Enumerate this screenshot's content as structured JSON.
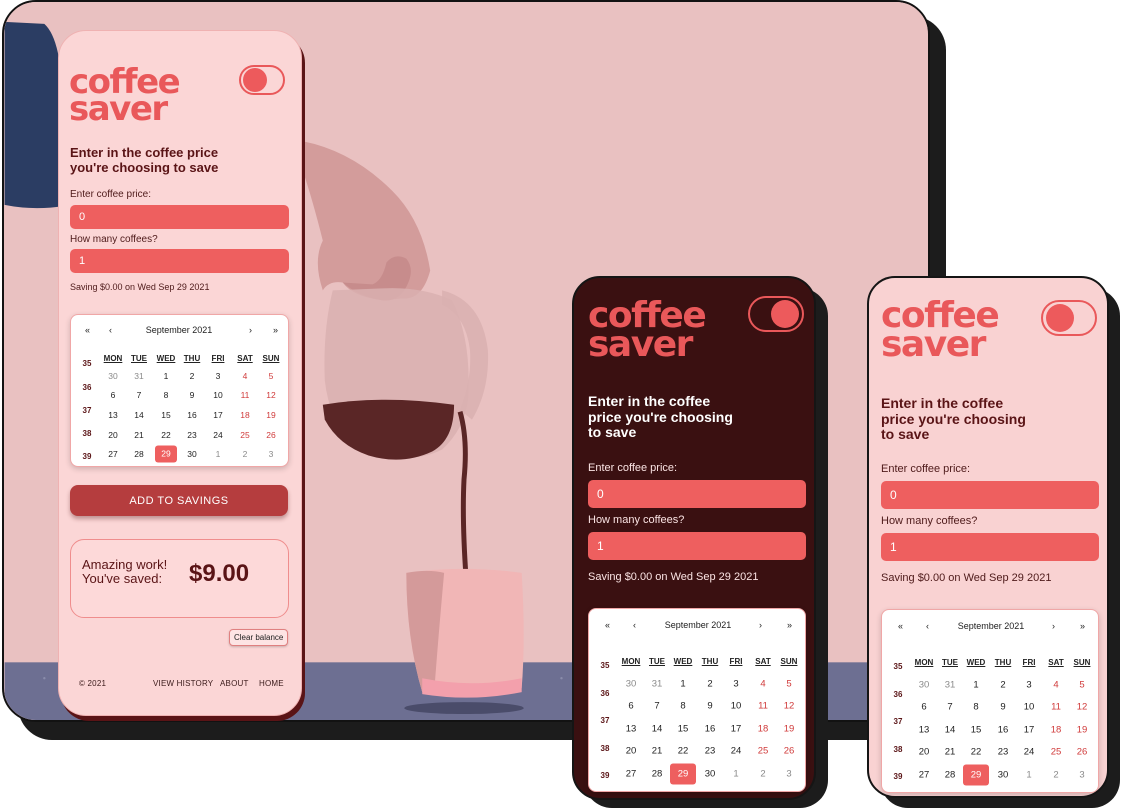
{
  "app": {
    "logo_line1": "coffee",
    "logo_line2": "saver",
    "heading_line1": "Enter in the coffee",
    "heading_line2": "price you're choosing",
    "heading_line3": "to save",
    "heading_wide_line1": "Enter in the coffee price",
    "heading_wide_line2": "you're choosing to save",
    "price_label": "Enter coffee price:",
    "price_value": "0",
    "count_label": "How many coffees?",
    "count_value": "1",
    "saving_text": "Saving $0.00 on Wed Sep 29 2021",
    "add_button": "ADD TO SAVINGS",
    "savings_msg_line1": "Amazing work!",
    "savings_msg_line2": "You've saved:",
    "savings_amount": "$9.00",
    "clear_button": "Clear balance",
    "footer": {
      "copyright": "© 2021",
      "links": [
        "VIEW HISTORY",
        "ABOUT",
        "HOME"
      ]
    }
  },
  "calendar": {
    "month_label": "September 2021",
    "nav_prev_year": "«",
    "nav_prev_month": "‹",
    "nav_next_month": "›",
    "nav_next_year": "»",
    "weekdays": [
      "MON",
      "TUE",
      "WED",
      "THU",
      "FRI",
      "SAT",
      "SUN"
    ],
    "weeks": [
      "35",
      "36",
      "37",
      "38",
      "39"
    ],
    "rows": [
      [
        "30",
        "31",
        "1",
        "2",
        "3",
        "4",
        "5"
      ],
      [
        "6",
        "7",
        "8",
        "9",
        "10",
        "11",
        "12"
      ],
      [
        "13",
        "14",
        "15",
        "16",
        "17",
        "18",
        "19"
      ],
      [
        "20",
        "21",
        "22",
        "23",
        "24",
        "25",
        "26"
      ],
      [
        "27",
        "28",
        "29",
        "30",
        "1",
        "2",
        "3"
      ]
    ],
    "selected_day": "29"
  },
  "colors": {
    "accent": "#ee5f5f",
    "button": "#b53d3e",
    "dark_bg": "#3a1011",
    "light_bg": "#fbd6d6",
    "text_dark": "#5a1416"
  }
}
